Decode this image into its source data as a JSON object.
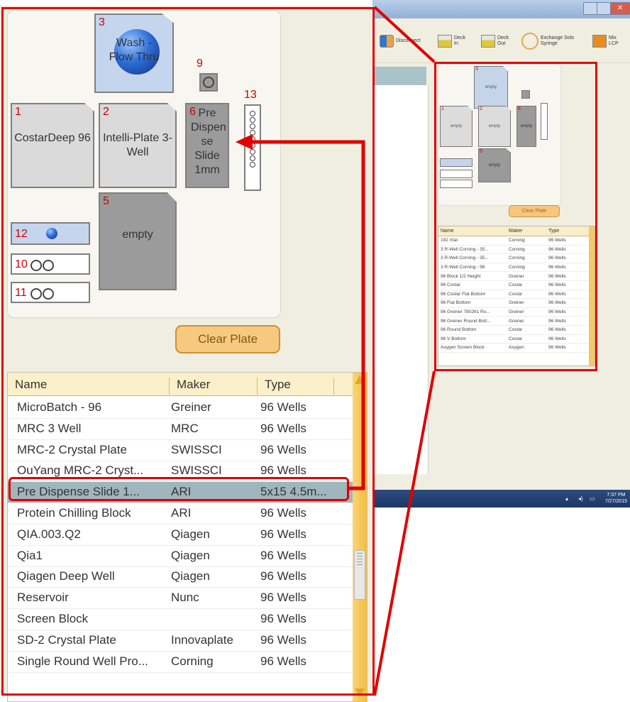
{
  "small_window": {
    "toolbar": {
      "disconnect": "Disconnect",
      "deck_in": "Deck In",
      "deck_out": "Deck Out",
      "exchange": "Exchange Solo Syringe",
      "mix_lcp": "Mix LCP"
    },
    "deck": {
      "slot3": "empty",
      "slot1": "empty",
      "slot2": "empty",
      "slot6": "empty",
      "slot5": "empty"
    },
    "clear_plate": "Clear Plate",
    "list": {
      "headers": {
        "name": "Name",
        "maker": "Maker",
        "type": "Type"
      },
      "rows": [
        [
          "192 Xtal",
          "Corning",
          "96 Wells"
        ],
        [
          "3 R-Well Corning - 35...",
          "Corning",
          "96 Wells"
        ],
        [
          "3 R-Well Corning - 35...",
          "Corning",
          "96 Wells"
        ],
        [
          "3 R-Well Corning - 96",
          "Corning",
          "96 Wells"
        ],
        [
          "96 Block 1/2 Height",
          "Greiner",
          "96 Wells"
        ],
        [
          "96 Costar",
          "Costar",
          "96 Wells"
        ],
        [
          "96 Costar Flat Bottom",
          "Costar",
          "96 Wells"
        ],
        [
          "96 Flat Bottom",
          "Greiner",
          "96 Wells"
        ],
        [
          "96 Greiner 780261 Ro...",
          "Greiner",
          "96 Wells"
        ],
        [
          "96 Greiner Round Bott...",
          "Greiner",
          "96 Wells"
        ],
        [
          "96 Round Bottom",
          "Costar",
          "96 Wells"
        ],
        [
          "96 V Bottom",
          "Costar",
          "96 Wells"
        ],
        [
          "Axygen Screen Block",
          "Axygen",
          "96 Wells"
        ]
      ]
    },
    "time": "7:37 PM",
    "date": "7/27/2015"
  },
  "zoom": {
    "slots": {
      "s3_num": "3",
      "s3_text": "Wash - Flow Thru",
      "s9_num": "9",
      "s13_num": "13",
      "s1_num": "1",
      "s1_text": "CostarDeep 96",
      "s2_num": "2",
      "s2_text": "Intelli-Plate 3-Well",
      "s6_num": "6",
      "s6_text": "Pre Dispen se Slide 1mm",
      "s5_num": "5",
      "s5_text": "empty",
      "s12_num": "12",
      "s10_num": "10",
      "s11_num": "11"
    },
    "clear_plate": "Clear Plate",
    "list": {
      "headers": {
        "name": "Name",
        "maker": "Maker",
        "type": "Type"
      },
      "rows": [
        {
          "name": "MicroBatch - 96",
          "maker": "Greiner",
          "type": "96 Wells"
        },
        {
          "name": "MRC 3 Well",
          "maker": "MRC",
          "type": "96 Wells"
        },
        {
          "name": "MRC-2 Crystal Plate",
          "maker": "SWISSCI",
          "type": "96 Wells"
        },
        {
          "name": "OuYang MRC-2 Cryst...",
          "maker": "SWISSCI",
          "type": "96 Wells"
        },
        {
          "name": "Pre Dispense Slide 1...",
          "maker": "ARI",
          "type": "5x15 4.5m..."
        },
        {
          "name": "Protein Chilling Block",
          "maker": "ARI",
          "type": "96 Wells"
        },
        {
          "name": "QIA.003.Q2",
          "maker": "Qiagen",
          "type": "96 Wells"
        },
        {
          "name": "Qia1",
          "maker": "Qiagen",
          "type": "96 Wells"
        },
        {
          "name": "Qiagen Deep Well",
          "maker": "Qiagen",
          "type": "96 Wells"
        },
        {
          "name": "Reservoir",
          "maker": "Nunc",
          "type": "96 Wells"
        },
        {
          "name": "Screen Block",
          "maker": "",
          "type": "96 Wells"
        },
        {
          "name": "SD-2 Crystal Plate",
          "maker": "Innovaplate",
          "type": "96 Wells"
        },
        {
          "name": "Single Round Well Pro...",
          "maker": "Corning",
          "type": "96 Wells"
        }
      ],
      "selected_index": 4
    }
  },
  "colors": {
    "highlight_red": "#e00000",
    "selected_row": "#9fb6bd",
    "button_orange": "#f7c87f",
    "slot_number_red": "#cc0000"
  }
}
